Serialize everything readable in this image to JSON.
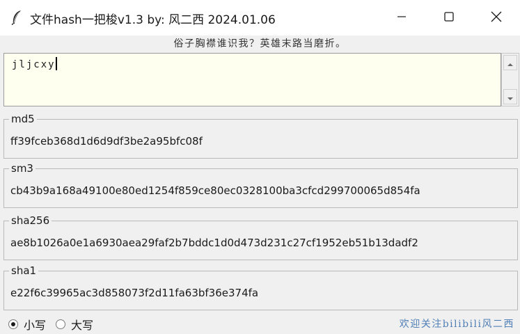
{
  "window": {
    "title": "文件hash一把梭v1.3  by: 风二西 2024.01.06",
    "controls": [
      "minimize",
      "maximize",
      "close"
    ]
  },
  "motto": "俗子胸襟谁识我？英雄末路当磨折。",
  "input": {
    "value": "jljcxy"
  },
  "hashes": [
    {
      "label": "md5",
      "value": "ff39fceb368d1d6d9df3be2a95bfc08f"
    },
    {
      "label": "sm3",
      "value": "cb43b9a168a49100e80ed1254f859ce80ec0328100ba3cfcd299700065d854fa"
    },
    {
      "label": "sha256",
      "value": "ae8b1026a0e1a6930aea29faf2b7bddc1d0d473d231c27cf1952eb51b13dadf2"
    },
    {
      "label": "sha1",
      "value": "e22f6c39965ac3d858073f2d11fa63bf36e374fa"
    }
  ],
  "case_options": {
    "lower_label": "小写",
    "upper_label": "大写",
    "selected": "lower"
  },
  "footer": {
    "text": "欢迎关注bilibili风二西"
  },
  "colors": {
    "input_bg": "#fffff0",
    "footer_text": "#4f7fb6",
    "window_bg": "#f0f0f0"
  },
  "icons": {
    "app": "feather-icon",
    "minimize": "minimize-icon",
    "maximize": "maximize-icon",
    "close": "close-icon",
    "scroll_up": "arrow-up-icon",
    "scroll_down": "arrow-down-icon"
  }
}
